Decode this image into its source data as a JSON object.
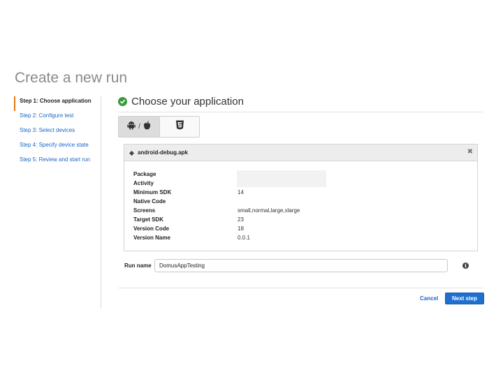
{
  "page": {
    "title": "Create a new run"
  },
  "steps": [
    {
      "label": "Step 1: Choose application",
      "active": true
    },
    {
      "label": "Step 2: Configure test"
    },
    {
      "label": "Step 3: Select devices"
    },
    {
      "label": "Step 4: Specify device state"
    },
    {
      "label": "Step 5: Review and start run"
    }
  ],
  "main": {
    "heading": "Choose your application",
    "platform_toggle": {
      "native_icons": [
        "android-icon",
        "apple-icon"
      ],
      "separator": "/",
      "web_icon": "html5-icon",
      "selected": "native"
    },
    "application": {
      "file_name": "android-debug.apk",
      "details": [
        {
          "label": "Package",
          "value": ""
        },
        {
          "label": "Activity",
          "value": ""
        },
        {
          "label": "Minimum SDK",
          "value": "14"
        },
        {
          "label": "Native Code",
          "value": ""
        },
        {
          "label": "Screens",
          "value": "small,normal,large,xlarge"
        },
        {
          "label": "Target SDK",
          "value": "23"
        },
        {
          "label": "Version Code",
          "value": "18"
        },
        {
          "label": "Version Name",
          "value": "0.0.1"
        }
      ]
    },
    "run_name": {
      "label": "Run name",
      "value": "DomusAppTesting"
    }
  },
  "footer": {
    "cancel_label": "Cancel",
    "next_label": "Next step"
  },
  "colors": {
    "accent": "#e47911",
    "link": "#1a66c7",
    "primary_button": "#1f6fd1",
    "success": "#3c9a3c"
  }
}
